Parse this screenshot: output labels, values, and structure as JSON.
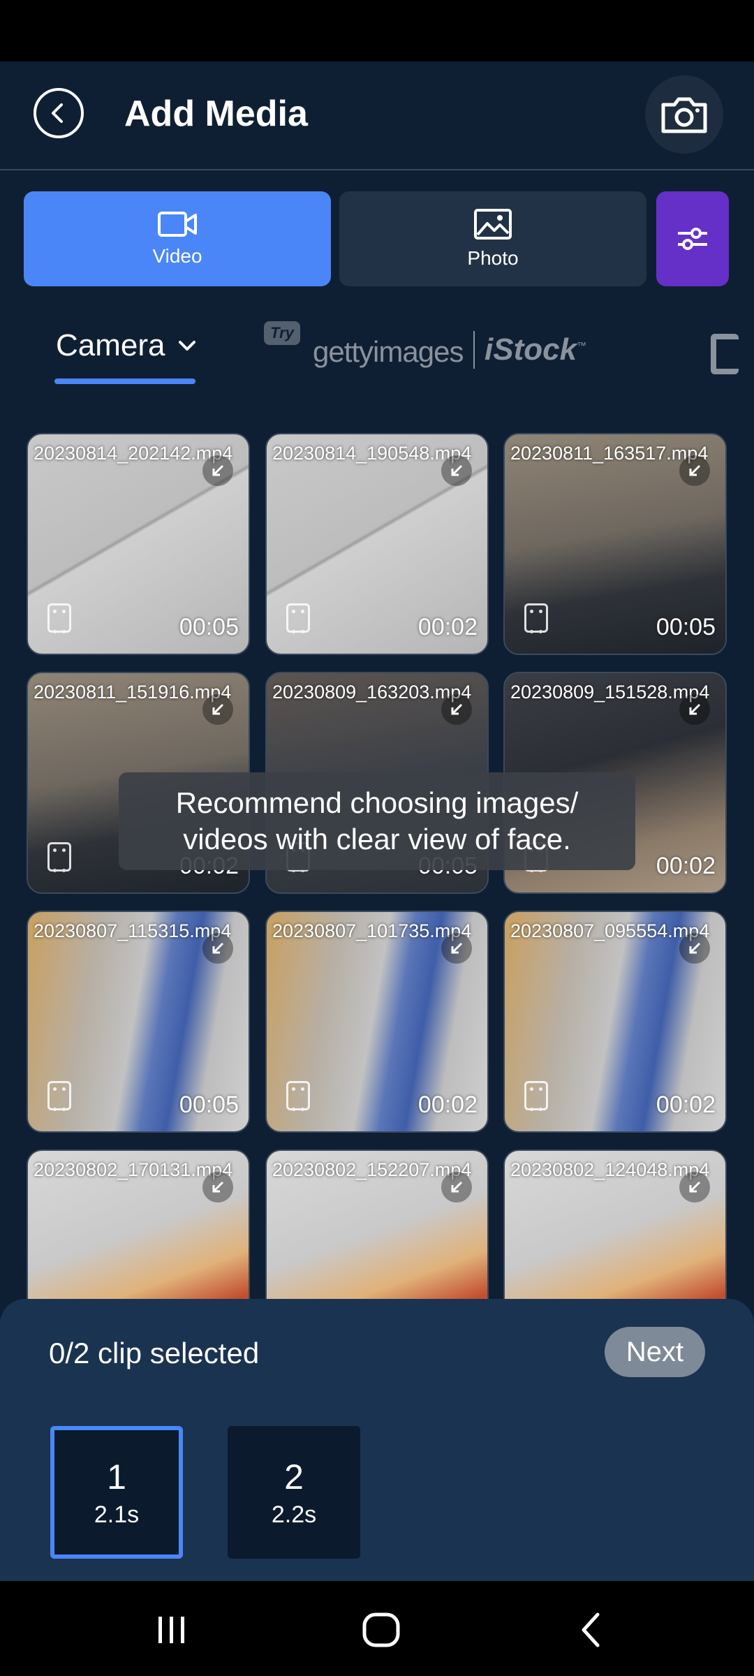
{
  "header": {
    "title": "Add Media",
    "back_icon": "back-circle-icon",
    "camera_icon": "camera-icon"
  },
  "media_type_tabs": [
    {
      "label": "Video",
      "icon": "video-camera-icon",
      "selected": true
    },
    {
      "label": "Photo",
      "icon": "image-icon",
      "selected": false
    }
  ],
  "filter": {
    "icon": "filter-sliders-icon"
  },
  "sources": {
    "selected": "Camera",
    "try_badge": "Try",
    "getty_logo": "gettyimages",
    "istock_logo": "iStock",
    "istock_tm": "™"
  },
  "media_items": [
    {
      "filename": "20230814_202142.mp4",
      "duration": "00:05",
      "thumb": "a"
    },
    {
      "filename": "20230814_190548.mp4",
      "duration": "00:02",
      "thumb": "a"
    },
    {
      "filename": "20230811_163517.mp4",
      "duration": "00:05",
      "thumb": "b"
    },
    {
      "filename": "20230811_151916.mp4",
      "duration": "00:02",
      "thumb": "b"
    },
    {
      "filename": "20230809_163203.mp4",
      "duration": "00:05",
      "thumb": "c"
    },
    {
      "filename": "20230809_151528.mp4",
      "duration": "00:02",
      "thumb": "d"
    },
    {
      "filename": "20230807_115315.mp4",
      "duration": "00:05",
      "thumb": "e"
    },
    {
      "filename": "20230807_101735.mp4",
      "duration": "00:02",
      "thumb": "e"
    },
    {
      "filename": "20230807_095554.mp4",
      "duration": "00:02",
      "thumb": "e"
    },
    {
      "filename": "20230802_170131.mp4",
      "duration": "",
      "thumb": "f"
    },
    {
      "filename": "20230802_152207.mp4",
      "duration": "",
      "thumb": "f"
    },
    {
      "filename": "20230802_124048.mp4",
      "duration": "",
      "thumb": "f"
    }
  ],
  "toast": "Recommend choosing images/ videos with clear view of face.",
  "bottom_panel": {
    "selection_text": "0/2 clip selected",
    "next_label": "Next",
    "slots": [
      {
        "number": "1",
        "duration": "2.1s",
        "active": true
      },
      {
        "number": "2",
        "duration": "2.2s",
        "active": false
      }
    ]
  },
  "colors": {
    "accent": "#4a86f7",
    "filter_purple": "#6430c8",
    "background": "#0f1f33",
    "panel": "#1a3350"
  }
}
